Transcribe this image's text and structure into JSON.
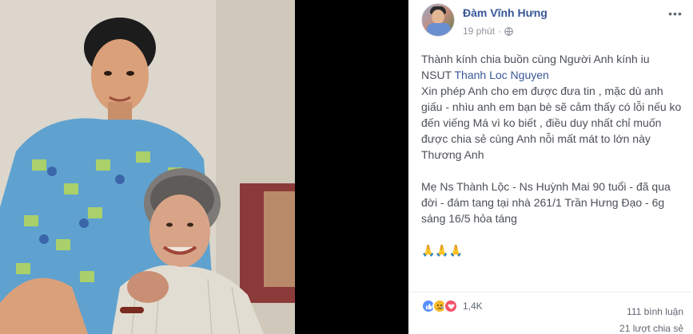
{
  "post": {
    "author": "Đàm Vĩnh Hưng",
    "time": "19 phút",
    "separator": "·",
    "privacy_icon": "globe-icon",
    "more_icon": "more-options-icon",
    "text": {
      "line1": "Thành kính chia buồn cùng Người Anh kính iu",
      "line2_prefix": "NSUT ",
      "mention": "Thanh Loc Nguyen",
      "line3": "Xin phép Anh cho em được đưa tin , mặc dù anh giấu - nhìu anh em bạn bè sẽ cảm thấy có lỗi nếu ko đến viếng Má vì ko biết , điều duy nhất chỉ muốn được chia sẻ cùng Anh nỗi mất mát to lớn này",
      "line4": "Thương Anh",
      "line5": "Mẹ Ns Thành Lộc - Ns Huỳnh Mai 90 tuổi - đã qua đời - đám tang tại nhà 261/1 Trần Hưng Đạo - 6g sáng 16/5 hỏa táng",
      "emojis": "🙏🙏🙏"
    }
  },
  "footer": {
    "reactions": [
      "like",
      "sad",
      "love"
    ],
    "reaction_count": "1,4K",
    "comments": "111 bình luận",
    "shares": "21 lượt chia sẻ"
  },
  "colors": {
    "link": "#385898",
    "text": "#4b4f56",
    "meta": "#90949c"
  }
}
